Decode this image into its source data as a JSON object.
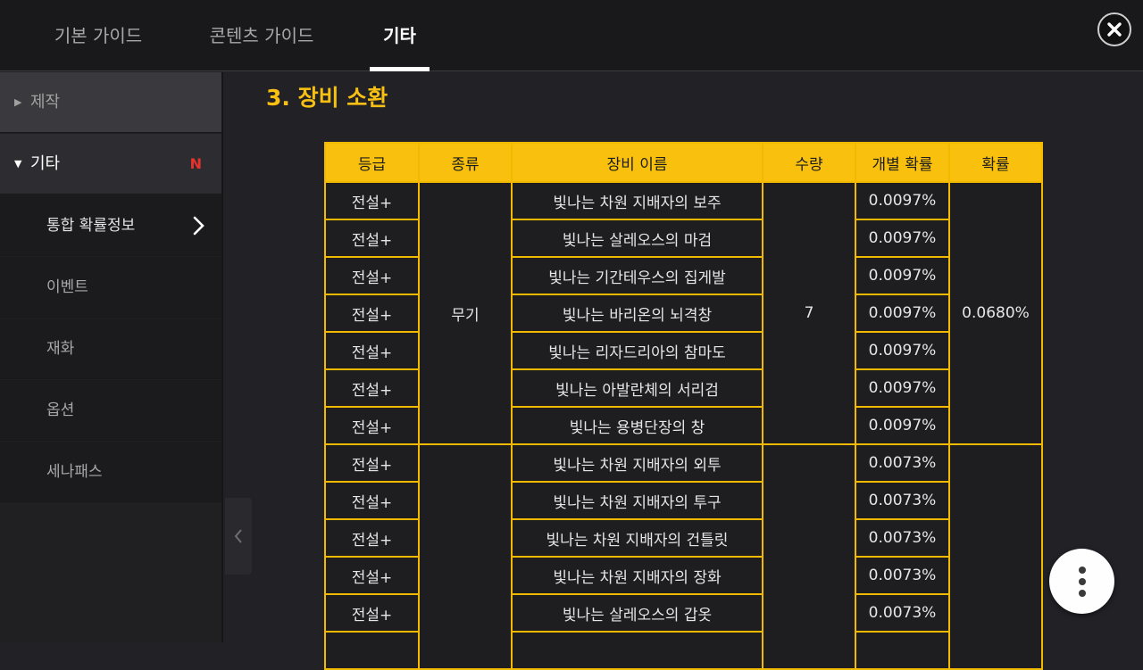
{
  "tabs": [
    "기본 가이드",
    "콘텐츠 가이드",
    "기타"
  ],
  "sidebar": {
    "categories": [
      {
        "label": "제작",
        "expanded": false
      },
      {
        "label": "기타",
        "expanded": true,
        "badge": "N"
      }
    ],
    "sub_items": [
      "통합 확률정보",
      "이벤트",
      "재화",
      "옵션",
      "세나패스"
    ]
  },
  "section_title": "3. 장비 소환",
  "table": {
    "headers": [
      "등급",
      "종류",
      "장비 이름",
      "수량",
      "개별 확률",
      "확률"
    ],
    "groups": [
      {
        "type": "무기",
        "count": "7",
        "total": "0.0680%",
        "rows": [
          {
            "grade": "전설+",
            "name": "빛나는 차원 지배자의 보주",
            "prob": "0.0097%"
          },
          {
            "grade": "전설+",
            "name": "빛나는 살레오스의 마검",
            "prob": "0.0097%"
          },
          {
            "grade": "전설+",
            "name": "빛나는 기간테우스의 집게발",
            "prob": "0.0097%"
          },
          {
            "grade": "전설+",
            "name": "빛나는 바리온의 뇌격창",
            "prob": "0.0097%"
          },
          {
            "grade": "전설+",
            "name": "빛나는 리자드리아의 참마도",
            "prob": "0.0097%"
          },
          {
            "grade": "전설+",
            "name": "빛나는 아발란체의 서리검",
            "prob": "0.0097%"
          },
          {
            "grade": "전설+",
            "name": "빛나는 용병단장의 창",
            "prob": "0.0097%"
          }
        ]
      },
      {
        "type": "",
        "count": "",
        "total": "",
        "rows": [
          {
            "grade": "전설+",
            "name": "빛나는 차원 지배자의 외투",
            "prob": "0.0073%"
          },
          {
            "grade": "전설+",
            "name": "빛나는 차원 지배자의 투구",
            "prob": "0.0073%"
          },
          {
            "grade": "전설+",
            "name": "빛나는 차원 지배자의 건틀릿",
            "prob": "0.0073%"
          },
          {
            "grade": "전설+",
            "name": "빛나는 차원 지배자의 장화",
            "prob": "0.0073%"
          },
          {
            "grade": "전설+",
            "name": "빛나는 살레오스의 갑옷",
            "prob": "0.0073%"
          }
        ]
      }
    ]
  },
  "icons": {
    "close": "close-icon",
    "back": "chevron-left-icon",
    "more": "more-vertical-icon",
    "arrow": "chevron-right-icon"
  },
  "colors": {
    "accent": "#f9c10d",
    "badge": "#e8322c"
  }
}
